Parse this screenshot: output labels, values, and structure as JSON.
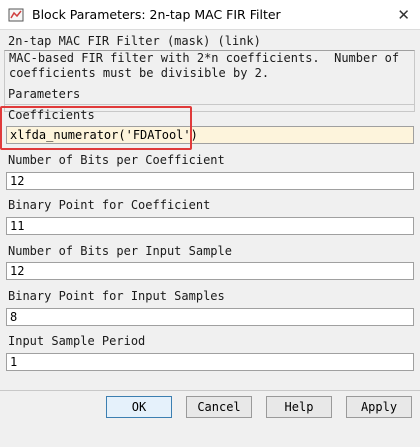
{
  "window": {
    "title": "Block Parameters: 2n-tap  MAC FIR Filter",
    "close_glyph": "✕",
    "icon": "block-parameters-icon"
  },
  "block": {
    "type_line": "2n-tap MAC FIR Filter (mask) (link)",
    "description_line1": "MAC-based FIR filter with 2*n coefficients.  Number of",
    "description_line2": "coefficients must be divisible by 2."
  },
  "parameters": {
    "header": "Parameters",
    "fields": [
      {
        "label": "Coefficients",
        "value": "xlfda_numerator('FDATool')"
      },
      {
        "label": "Number of Bits per Coefficient",
        "value": "12"
      },
      {
        "label": "Binary Point for Coefficient",
        "value": "11"
      },
      {
        "label": "Number of Bits per Input Sample",
        "value": "12"
      },
      {
        "label": "Binary Point for Input Samples",
        "value": "8"
      },
      {
        "label": "Input Sample Period",
        "value": "1"
      }
    ]
  },
  "buttons": {
    "ok": "OK",
    "cancel": "Cancel",
    "help": "Help",
    "apply": "Apply"
  },
  "colors": {
    "highlight_box": "#e03a3a",
    "active_field_bg": "#fdf4dc"
  }
}
